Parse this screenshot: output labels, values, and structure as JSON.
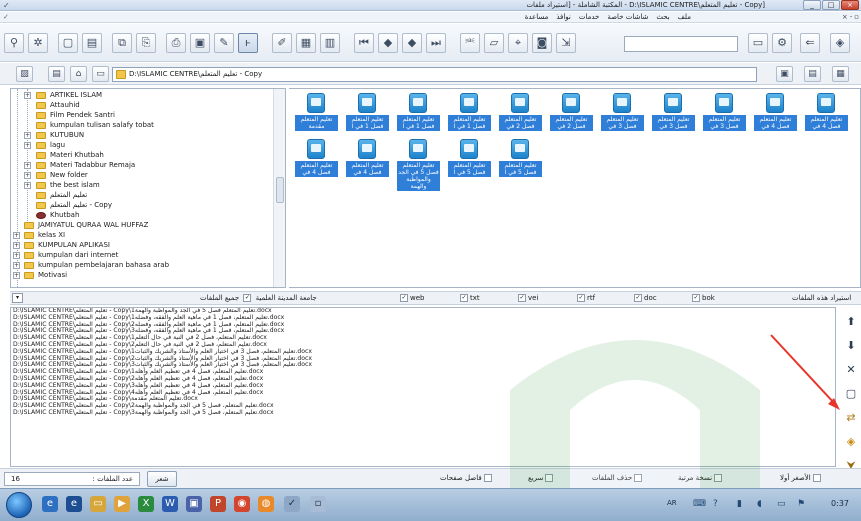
{
  "window": {
    "title": "[Copy - تعليم المتعلم\\D:\\ISLAMIC CENTRE - المكتبة الشاملة - [استيراد ملفات",
    "controls": [
      "_",
      "□",
      "×"
    ]
  },
  "menu": {
    "items": [
      "ملف",
      "بحث",
      "شاشات خاصة",
      "خدمات",
      "نوافذ",
      "مساعدة"
    ],
    "mdi": [
      "×",
      "-",
      "▫"
    ]
  },
  "address": {
    "path": "D:\\ISLAMIC CENTRE\\تعليم المتعلم - Copy"
  },
  "tree": {
    "items": [
      {
        "label": "ARTIKEL ISLAM",
        "level": 2,
        "expander": "+"
      },
      {
        "label": "Attauhid",
        "level": 2,
        "expander": ""
      },
      {
        "label": "Film Pendek Santri",
        "level": 2,
        "expander": ""
      },
      {
        "label": "kumpulan tulisan salafy tobat",
        "level": 2,
        "expander": ""
      },
      {
        "label": "KUTUBUN",
        "level": 2,
        "expander": "+"
      },
      {
        "label": "lagu",
        "level": 2,
        "expander": "+"
      },
      {
        "label": "Materi Khutbah",
        "level": 2,
        "expander": ""
      },
      {
        "label": "Materi Tadabbur Remaja",
        "level": 2,
        "expander": "+"
      },
      {
        "label": "New folder",
        "level": 2,
        "expander": "+"
      },
      {
        "label": "the best islam",
        "level": 2,
        "expander": "+"
      },
      {
        "label": "تعليم المتعلم",
        "level": 2,
        "expander": ""
      },
      {
        "label": "تعليم المتعلم - Copy",
        "level": 2,
        "expander": ""
      },
      {
        "label": "Khutbah",
        "level": 2,
        "expander": ""
      },
      {
        "label": "JAMIYATUL QURAA WAL HUFFAZ",
        "level": 1,
        "expander": ""
      },
      {
        "label": "kelas XI",
        "level": 1,
        "expander": "+"
      },
      {
        "label": "KUMPULAN APLIKASI",
        "level": 1,
        "expander": "+"
      },
      {
        "label": "kumpulan dari internet",
        "level": 1,
        "expander": "+"
      },
      {
        "label": "kumpulan pembelajaran bahasa arab",
        "level": 1,
        "expander": "+"
      },
      {
        "label": "Motivasi",
        "level": 1,
        "expander": "+"
      }
    ]
  },
  "files": {
    "row1": [
      "تعليم المتعلم فصل 4 في",
      "تعليم المتعلم فصل 4 في",
      "تعليم المتعلم فصل 3 في",
      "تعليم المتعلم فصل 3 في",
      "تعليم المتعلم فصل 3 في",
      "تعليم المتعلم فصل 2 في",
      "تعليم المتعلم فصل 2 في",
      "تعليم المتعلم فصل 1 في ا",
      "تعليم المتعلم فصل 1 في ا",
      "تعليم المتعلم فصل 1 في ا",
      "تعليم المتعلم مقدمة"
    ],
    "row2": [
      "تعليم المتعلم فصل 4 في",
      "تعليم المتعلم فصل 4 في",
      "تعليم المتعلم فصل 5 في الجد والمواظبة والهمة",
      "تعليم المتعلم فصل 5 في ا",
      "تعليم المتعلم فصل 5 في ا"
    ]
  },
  "filters": {
    "all_files_label": "جميع الملفات",
    "university_label": "جامعة المدينة العلمية",
    "types": [
      "web",
      "txt",
      "vei",
      "rtf",
      "doc",
      "bok"
    ],
    "import_label": "استيراد هذه الملفات"
  },
  "list": {
    "rows": [
      "D:\\ISLAMIC CENTRE\\تعليم المتعلم - Copy\\تعليم المتعلم فصل 5 في الجد والمواظبة والهمة1.docx",
      "D:\\ISLAMIC CENTRE\\تعليم المتعلم - Copy\\تعليم المتعلم، فصل 1 في ماهية العلم والفقه، وفضله1.docx",
      "D:\\ISLAMIC CENTRE\\تعليم المتعلم - Copy\\تعليم المتعلم، فصل 1 في ماهية العلم والفقه، وفضله2.docx",
      "D:\\ISLAMIC CENTRE\\تعليم المتعلم - Copy\\تعليم المتعلم، فصل 1 في ماهية العلم والفقه، وفضله3.docx",
      "D:\\ISLAMIC CENTRE\\تعليم المتعلم - Copy\\تعليم المتعلم، فصل 2 في النية في حال التعلم1.docx",
      "D:\\ISLAMIC CENTRE\\تعليم المتعلم - Copy\\تعليم المتعلم، فصل 2 في النية في حال التعلم2.docx",
      "D:\\ISLAMIC CENTRE\\تعليم المتعلم - Copy\\تعليم المتعلم، فصل 3 في اختيار العلم والأستاذ والشريك والثبات1.docx",
      "D:\\ISLAMIC CENTRE\\تعليم المتعلم - Copy\\تعليم المتعلم، فصل 3 في اختيار العلم والأستاذ والشريك والثبات2.docx",
      "D:\\ISLAMIC CENTRE\\تعليم المتعلم - Copy\\تعليم المتعلم، فصل 3 في اختيار العلم والأستاذ والشريك والثبات3.docx",
      "D:\\ISLAMIC CENTRE\\تعليم المتعلم - Copy\\تعليم المتعلم، فصل 4 في تعظيم العلم وأهله1.docx",
      "D:\\ISLAMIC CENTRE\\تعليم المتعلم - Copy\\تعليم المتعلم، فصل 4 في تعظيم العلم وأهله2.docx",
      "D:\\ISLAMIC CENTRE\\تعليم المتعلم - Copy\\تعليم المتعلم، فصل 4 في تعظيم العلم وأهله3.docx",
      "D:\\ISLAMIC CENTRE\\تعليم المتعلم - Copy\\تعليم المتعلم، فصل 4 في تعظيم العلم وأهله4.docx",
      "D:\\ISLAMIC CENTRE\\تعليم المتعلم - Copy\\تعليم المتعلم مقدمة.docx",
      "D:\\ISLAMIC CENTRE\\تعليم المتعلم - Copy\\تعليم المتعلم، فصل 5 في الجد والمواظبة والهمة2.docx",
      "D:\\ISLAMIC CENTRE\\تعليم المتعلم - Copy\\تعليم المتعلم، فصل 5 في الجد والمواظبة والهمة3.docx"
    ]
  },
  "bottom": {
    "count_label": "عدد الملفات :",
    "count_value": "16",
    "go_label": "شعر",
    "opt_page_sep": "فاصل صفحات",
    "opt_fast": "سريع",
    "opt_delete_files": "حذف الملفات",
    "opt_copy": "نسخة مرتبة",
    "opt_smaller_first": "الأصغر أولا"
  },
  "taskbar": {
    "lang": "AR",
    "clock": "0:37"
  },
  "colors": {
    "selection": "#2f7ed8",
    "file_icon": "#1e83cc",
    "folder": "#f2c74e",
    "arrow": "#e8352b"
  }
}
